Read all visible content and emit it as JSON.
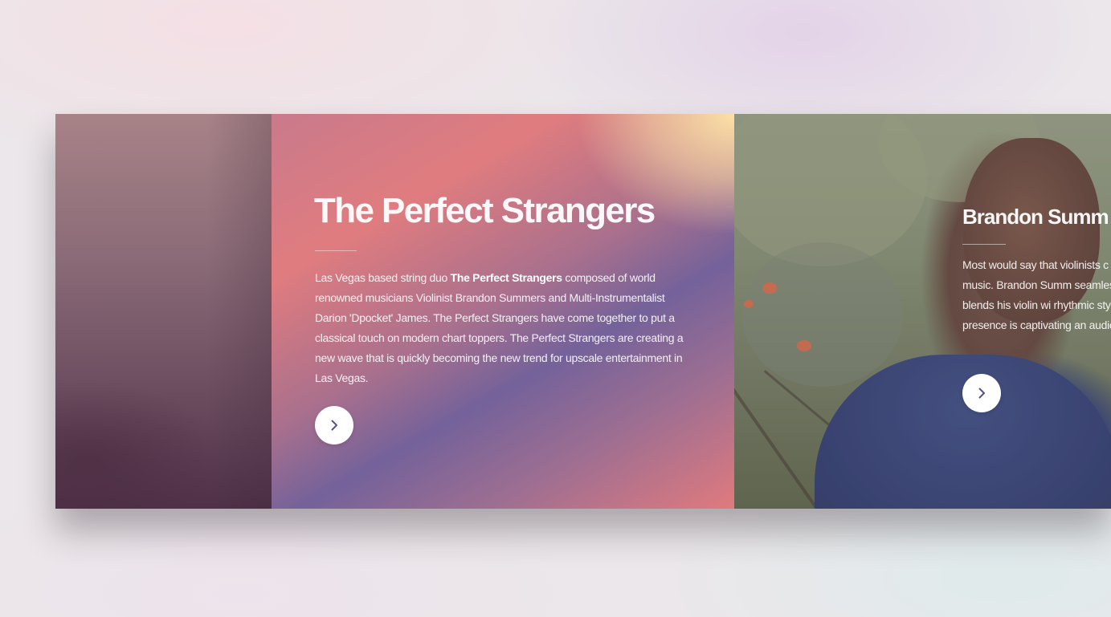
{
  "slides": {
    "active": {
      "title": "The Perfect Strangers",
      "text_before": "Las Vegas based string duo ",
      "text_bold": "The Perfect Strangers",
      "text_after": " composed of world renowned musicians Violinist Brandon Summers and Multi-Instrumentalist Darion 'Dpocket' James. The Perfect Strangers have come together to put a classical touch on modern chart toppers. The Perfect Strangers are creating a new wave that is quickly becoming the new trend for upscale entertainment in Las Vegas.",
      "button_icon": "chevron-right-icon"
    },
    "next": {
      "title": "Brandon Summ",
      "text": "Most would say that violinists c popular music. Brandon Summ seamlessly blends his violin wi rhythmic style and presence is captivating an audience...",
      "button_icon": "chevron-right-icon"
    }
  },
  "colors": {
    "button_bg": "#ffffff",
    "chevron": "#5b4f86",
    "text": "#ffffff"
  }
}
